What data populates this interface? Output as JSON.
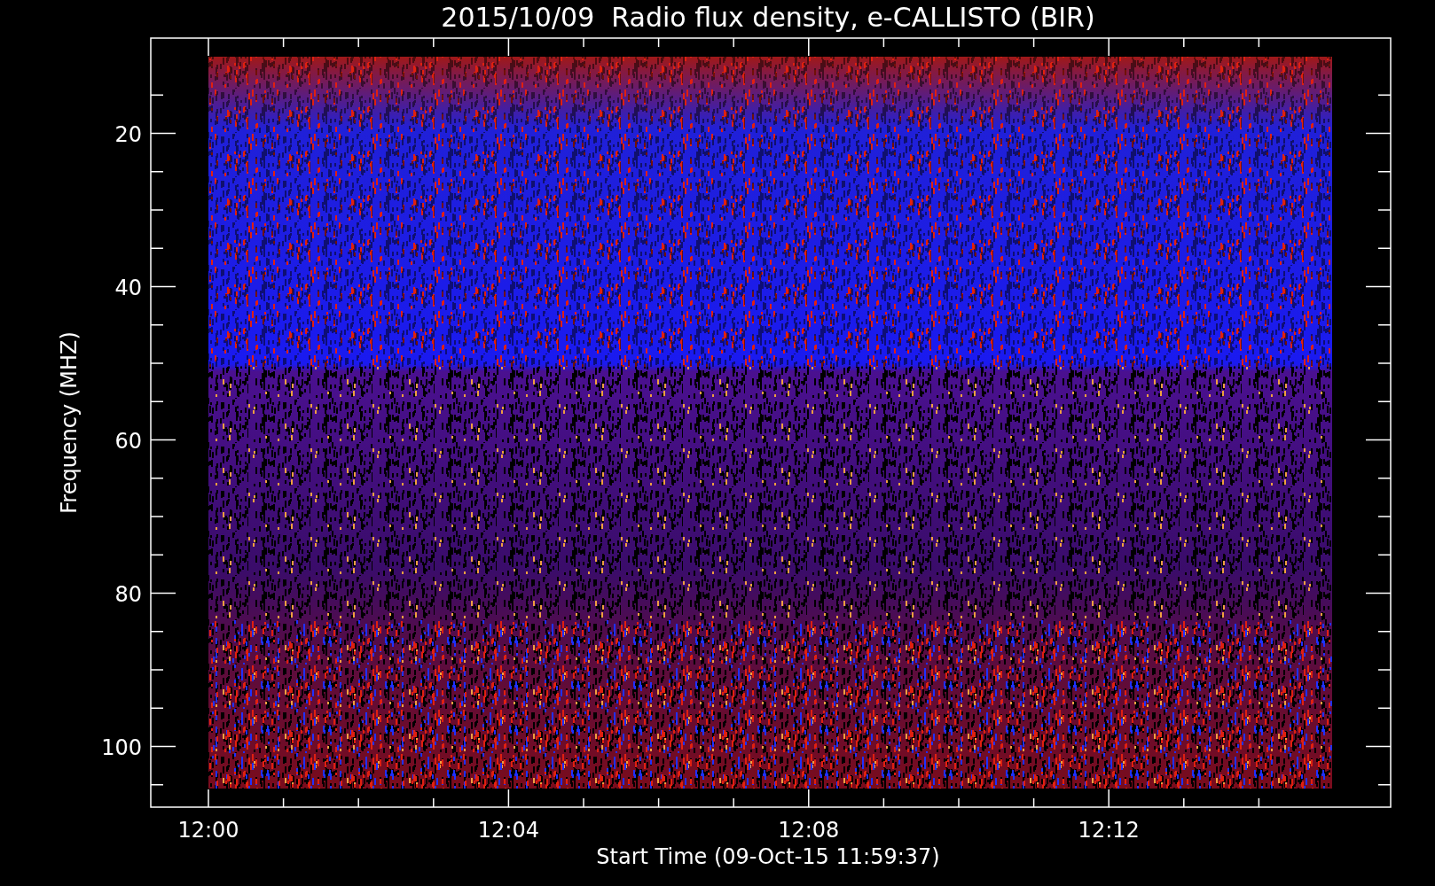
{
  "title": "2015/10/09  Radio flux density, e-CALLISTO (BIR)",
  "y_axis": {
    "label": "Frequency (MHZ)",
    "ticks": [
      "20",
      "40",
      "60",
      "80",
      "100"
    ]
  },
  "x_axis": {
    "label": "Start Time (09-Oct-15 11:59:37)",
    "ticks": [
      "12:00",
      "12:04",
      "12:08",
      "12:12"
    ]
  }
}
